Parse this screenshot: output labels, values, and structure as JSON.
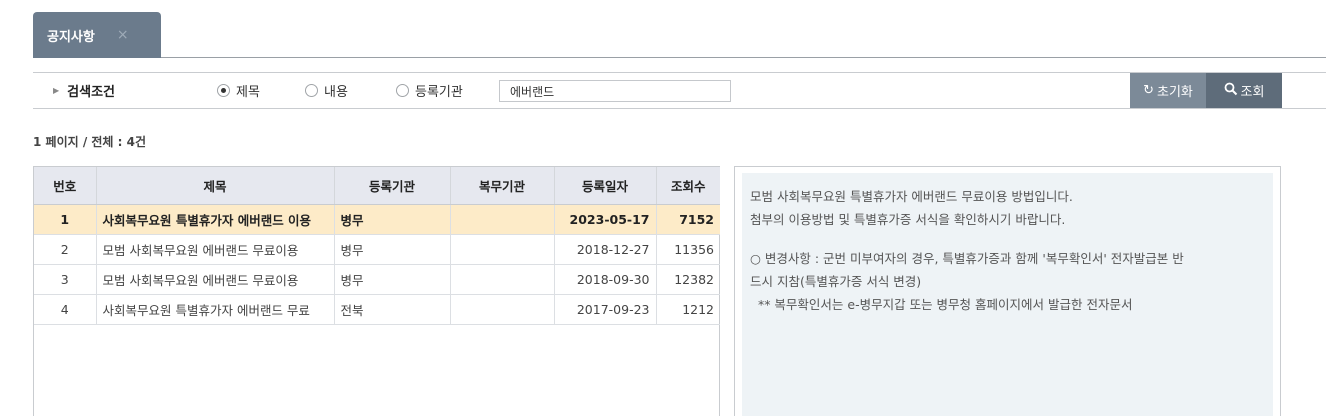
{
  "tab": {
    "label": "공지사항",
    "close": "×"
  },
  "search": {
    "label": "검색조건",
    "options": [
      "제목",
      "내용",
      "등록기관"
    ],
    "selected_index": 0,
    "keyword": "에버랜드",
    "reset_label": "초기화",
    "search_label": "조회"
  },
  "page_info": "1 페이지 / 전체 : 4건",
  "table": {
    "headers": [
      "번호",
      "제목",
      "등록기관",
      "복무기관",
      "등록일자",
      "조회수"
    ],
    "rows": [
      {
        "no": "1",
        "title": "사회복무요원 특별휴가자 에버랜드 이용",
        "org": "병무",
        "service": "",
        "date": "2023-05-17",
        "views": "7152",
        "selected": true
      },
      {
        "no": "2",
        "title": "모범 사회복무요원 에버랜드 무료이용",
        "org": "병무",
        "service": "",
        "date": "2018-12-27",
        "views": "11356",
        "selected": false
      },
      {
        "no": "3",
        "title": "모범 사회복무요원 에버랜드 무료이용",
        "org": "병무",
        "service": "",
        "date": "2018-09-30",
        "views": "12382",
        "selected": false
      },
      {
        "no": "4",
        "title": "사회복무요원 특별휴가자 에버랜드 무료",
        "org": "전북",
        "service": "",
        "date": "2017-09-23",
        "views": "1212",
        "selected": false
      }
    ]
  },
  "detail": {
    "line1": "모범 사회복무요원 특별휴가자 에버랜드 무료이용 방법입니다.",
    "line2": "첨부의 이용방법 및 특별휴가증 서식을 확인하시기 바랍니다.",
    "line3": "○ 변경사항 : 군번 미부여자의 경우, 특별휴가증과 함께 '복무확인서' 전자발급본 반",
    "line4": "드시 지참(특별휴가증 서식 변경)",
    "line5": "  ** 복무확인서는 e-병무지갑 또는 병무청 홈페이지에서 발급한 전자문서"
  },
  "colors": {
    "tab_bg": "#6b7b8c",
    "selected_row": "#fdebc8",
    "header_bg": "#e6e8ef",
    "detail_bg": "#eef3f6",
    "btn_reset": "#7c8a98",
    "btn_search": "#5e6c7a"
  },
  "icons": {
    "reset": "refresh-icon",
    "search": "magnifier-icon",
    "caret": "caret-right-icon"
  }
}
